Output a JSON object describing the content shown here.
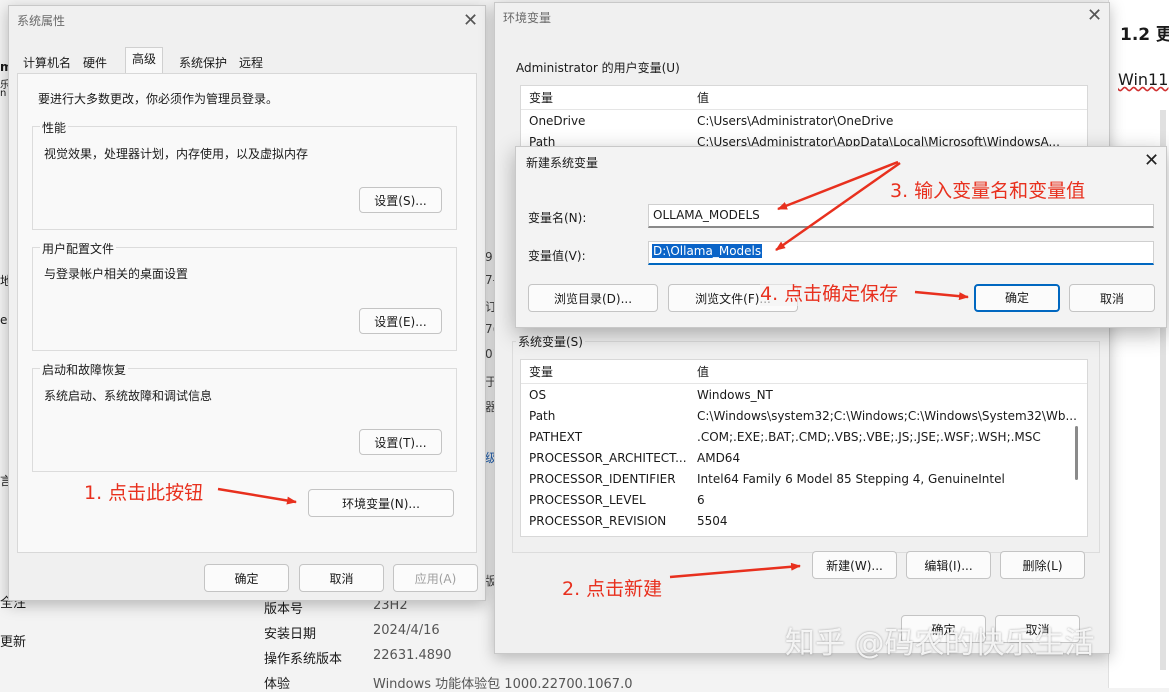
{
  "background_page": {
    "right_heading": "1.2 更",
    "right_text": "Win11",
    "left_edge": [
      "m",
      "乐",
      "n",
      "地",
      "e",
      "言",
      "全注",
      "更新"
    ],
    "mid_fragments": [
      "9",
      "7-2",
      "订",
      "7(",
      "01",
      "于",
      "器",
      "级"
    ],
    "props": [
      {
        "label": "版本号",
        "value": "23H2"
      },
      {
        "label": "安装日期",
        "value": "2024/4/16"
      },
      {
        "label": "操作系统版本",
        "value": "22631.4890"
      },
      {
        "label": "体验",
        "value": "Windows 功能体验包 1000.22700.1067.0"
      }
    ],
    "frag_ban": "版",
    "watermark": "知乎 @码农的快乐生活"
  },
  "sysprops": {
    "title": "系统属性",
    "tabs": [
      "计算机名",
      "硬件",
      "高级",
      "系统保护",
      "远程"
    ],
    "active_tab": "高级",
    "admin_note": "要进行大多数更改，你必须作为管理员登录。",
    "groups": [
      {
        "label": "性能",
        "desc": "视觉效果，处理器计划，内存使用，以及虚拟内存",
        "button": "设置(S)..."
      },
      {
        "label": "用户配置文件",
        "desc": "与登录帐户相关的桌面设置",
        "button": "设置(E)..."
      },
      {
        "label": "启动和故障恢复",
        "desc": "系统启动、系统故障和调试信息",
        "button": "设置(T)..."
      }
    ],
    "env_button": "环境变量(N)...",
    "ok": "确定",
    "cancel": "取消",
    "apply": "应用(A)"
  },
  "envvars": {
    "title": "环境变量",
    "user_section": "Administrator 的用户变量(U)",
    "col_var": "变量",
    "col_val": "值",
    "user_rows": [
      {
        "name": "OneDrive",
        "value": "C:\\Users\\Administrator\\OneDrive"
      },
      {
        "name": "Path",
        "value": "C:\\Users\\Administrator\\AppData\\Local\\Microsoft\\WindowsA..."
      }
    ],
    "sys_section": "系统变量(S)",
    "sys_rows": [
      {
        "name": "OS",
        "value": "Windows_NT"
      },
      {
        "name": "Path",
        "value": "C:\\Windows\\system32;C:\\Windows;C:\\Windows\\System32\\Wb..."
      },
      {
        "name": "PATHEXT",
        "value": ".COM;.EXE;.BAT;.CMD;.VBS;.VBE;.JS;.JSE;.WSF;.WSH;.MSC"
      },
      {
        "name": "PROCESSOR_ARCHITECT...",
        "value": "AMD64"
      },
      {
        "name": "PROCESSOR_IDENTIFIER",
        "value": "Intel64 Family 6 Model 85 Stepping 4, GenuineIntel"
      },
      {
        "name": "PROCESSOR_LEVEL",
        "value": "6"
      },
      {
        "name": "PROCESSOR_REVISION",
        "value": "5504"
      }
    ],
    "new_btn": "新建(W)...",
    "edit_btn": "编辑(I)...",
    "delete_btn": "删除(L)",
    "ok": "确定",
    "cancel": "取消"
  },
  "newvar": {
    "title": "新建系统变量",
    "name_label": "变量名(N):",
    "name_value": "OLLAMA_MODELS",
    "value_label": "变量值(V):",
    "value_value": "D:\\Ollama_Models",
    "browse_dir": "浏览目录(D)...",
    "browse_file": "浏览文件(F)...",
    "ok": "确定",
    "cancel": "取消"
  },
  "annotations": {
    "step1": "1. 点击此按钮",
    "step2": "2. 点击新建",
    "step3": "3. 输入变量名和变量值",
    "step4": "4. 点击确定保存"
  },
  "colors": {
    "annotation": "#e8301e",
    "accent": "#0067c0",
    "selection": "#0a64c8"
  }
}
